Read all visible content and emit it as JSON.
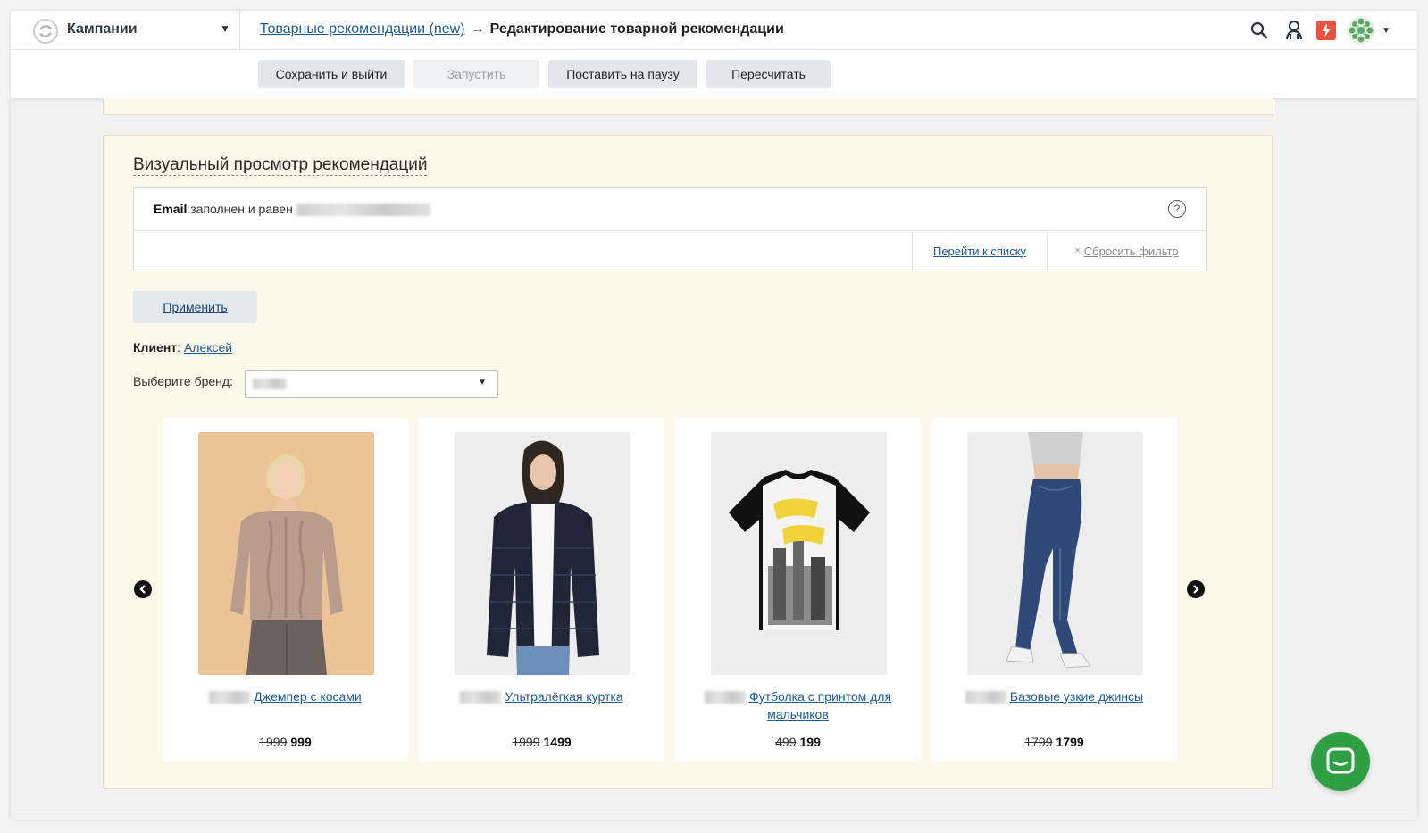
{
  "header": {
    "project_name": "Кампании",
    "breadcrumb": {
      "link": "Товарные рекомендации (new)",
      "arrow": "→",
      "current": "Редактирование товарной рекомендации"
    },
    "icons": [
      "search-icon",
      "user-icon",
      "flash-icon",
      "avatar-icon"
    ],
    "accent_color": "#e8503f"
  },
  "toolbar": {
    "save_exit_label": "Сохранить и выйти",
    "start_label": "Запустить",
    "pause_label": "Поставить на паузу",
    "recalc_label": "Пересчитать"
  },
  "preview": {
    "title": "Визуальный просмотр рекомендаций",
    "filter": {
      "field": "Email",
      "condition": "заполнен и равен",
      "help": "?",
      "goto_list": "Перейти к списку",
      "reset_x": "×",
      "reset": "Сбросить фильтр"
    },
    "apply_label": "Применить",
    "client_label": "Клиент",
    "client_name": "Алексей",
    "brand_label": "Выберите бренд:",
    "prev_icon": "chevron-left-icon",
    "next_icon": "chevron-right-icon",
    "products": [
      {
        "title": "Джемпер с косами",
        "old_price": "1999",
        "new_price": "999",
        "image": "knit-sweater"
      },
      {
        "title": "Ультралёгкая куртка",
        "old_price": "1999",
        "new_price": "1499",
        "image": "puffer-jacket"
      },
      {
        "title": "Футболка с принтом для мальчиков",
        "old_price": "499",
        "new_price": "199",
        "image": "printed-tshirt"
      },
      {
        "title": "Базовые узкие джинсы",
        "old_price": "1799",
        "new_price": "1799",
        "image": "skinny-jeans"
      }
    ]
  },
  "chat": {
    "icon": "chat-icon",
    "color": "#2ea043"
  }
}
